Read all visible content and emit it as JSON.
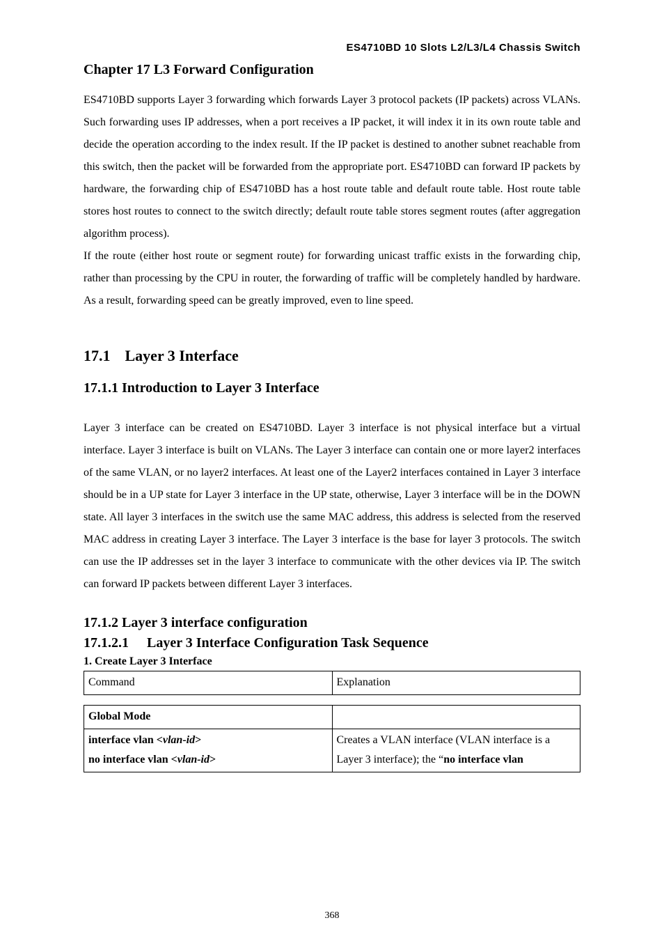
{
  "header": {
    "product_title": "ES4710BD 10 Slots L2/L3/L4 Chassis Switch"
  },
  "chapter": {
    "title": "Chapter 17 L3 Forward Configuration",
    "para1": "ES4710BD supports Layer 3 forwarding which forwards Layer 3 protocol packets (IP packets) across VLANs. Such forwarding uses IP addresses, when a port receives a IP packet, it will index it in its own route table and decide the operation according to the index result. If the IP packet is destined to another subnet reachable from this switch, then the packet will be forwarded from the appropriate port. ES4710BD can forward IP packets by hardware, the forwarding chip of ES4710BD has a host route table and default route table. Host route table stores host routes to connect to the switch directly; default route table stores segment routes (after aggregation algorithm process).",
    "para2": "If the route (either host route or segment route) for forwarding unicast traffic exists in the forwarding chip, rather than processing by the CPU in router, the forwarding of traffic will be completely handled by hardware. As a result, forwarding speed can be greatly improved, even to line speed."
  },
  "section_17_1": {
    "number": "17.1",
    "title": "Layer 3 Interface"
  },
  "section_17_1_1": {
    "heading": "17.1.1 Introduction to Layer 3 Interface",
    "para": "Layer 3 interface can be created on ES4710BD. Layer 3 interface is not physical interface but a virtual interface. Layer 3 interface is built on VLANs. The Layer 3 interface can contain one or more layer2 interfaces of the same VLAN, or no layer2 interfaces. At least one of the Layer2 interfaces contained in Layer 3 interface should be in a UP state for Layer 3 interface in the UP state, otherwise, Layer 3 interface will be in the DOWN state. All layer 3 interfaces in the switch use the same MAC address, this address is selected from the reserved MAC address in creating Layer 3 interface. The Layer 3 interface is the base for layer 3 protocols. The switch can use the IP addresses set in the layer 3 interface to communicate with the other devices via IP. The switch can forward IP packets between different Layer 3 interfaces."
  },
  "section_17_1_2": {
    "heading": "17.1.2 Layer 3 interface configuration"
  },
  "section_17_1_2_1": {
    "number": "17.1.2.1",
    "title": "Layer 3 Interface Configuration Task Sequence",
    "step1_title": "1. Create Layer 3 Interface",
    "table1": {
      "command_header": "Command",
      "explanation_header": "Explanation"
    },
    "table2": {
      "row1_left": "Global Mode",
      "row1_right": "",
      "row2_left_part1": "interface vlan <",
      "row2_left_italic": "vlan-id",
      "row2_left_part2": ">",
      "row3_left_part1": "no interface vlan <",
      "row3_left_italic": "vlan-id",
      "row3_left_part2": ">",
      "row2_right_part1": "Creates a VLAN interface (VLAN interface is a Layer 3 interface); the “",
      "row2_right_bold": "no interface vlan",
      "row2_right_part2": ""
    }
  },
  "footer": {
    "page_number": "368"
  }
}
